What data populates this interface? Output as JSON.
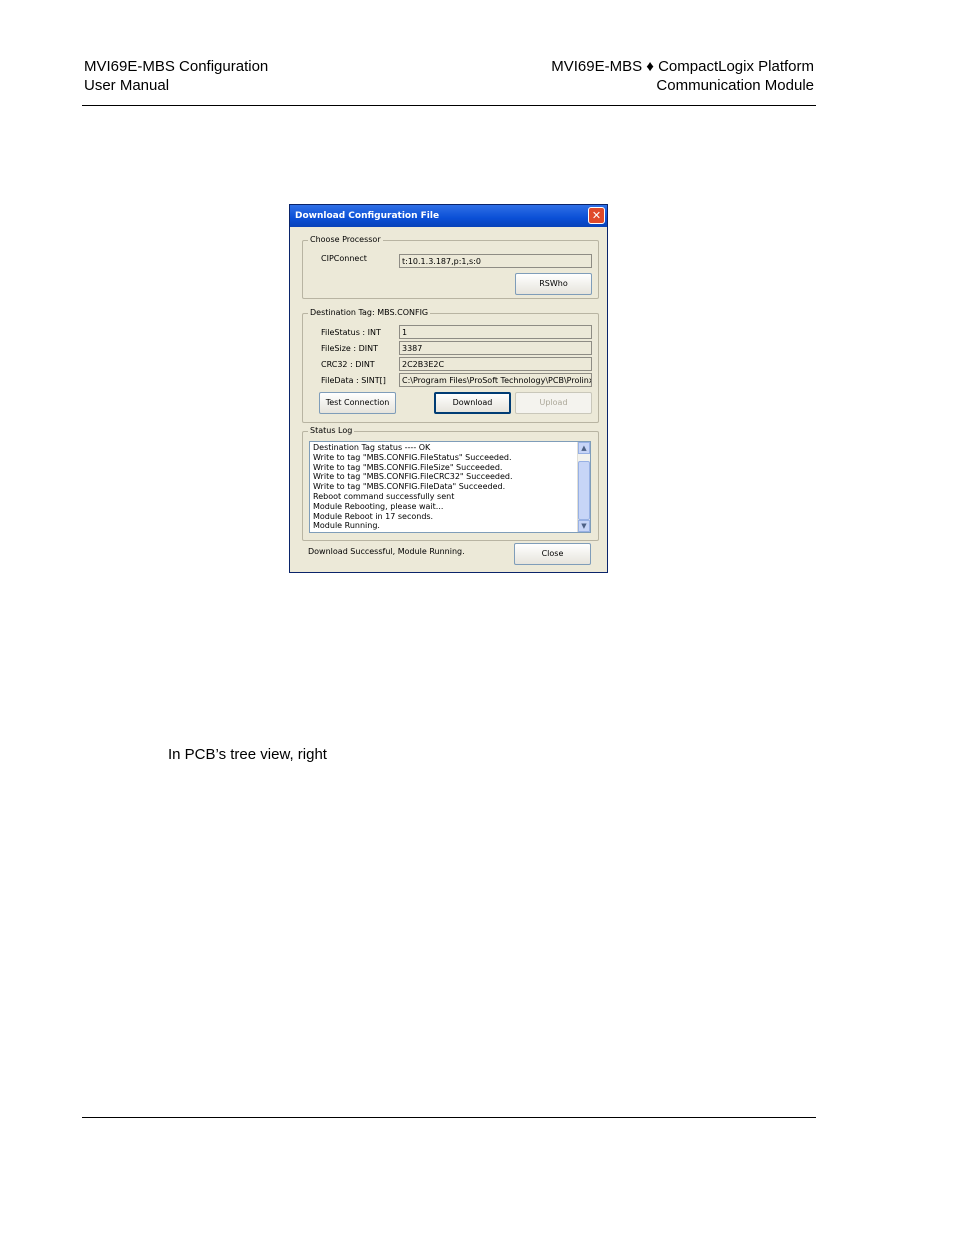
{
  "header": {
    "left_line1": "MVI69E-MBS Configuration",
    "left_line2": "User Manual",
    "right_line1": "MVI69E-MBS ♦ CompactLogix Platform",
    "right_line2": "Communication Module"
  },
  "body_text": "In PCB’s tree view, right",
  "dialog": {
    "title": "Download Configuration File",
    "choose_processor": {
      "group_label": "Choose Processor",
      "cipconnect_label": "CIPConnect",
      "cipconnect_value": "t:10.1.3.187,p:1,s:0",
      "rswho_button": "RSWho"
    },
    "destination": {
      "group_label": "Destination Tag: MBS.CONFIG",
      "rows": [
        {
          "label": "FileStatus : INT",
          "value": "1"
        },
        {
          "label": "FileSize    : DINT",
          "value": "3387"
        },
        {
          "label": "CRC32      : DINT",
          "value": "2C2B3E2C"
        },
        {
          "label": "FileData   : SINT[]",
          "value": "C:\\Program Files\\ProSoft Technology\\PCB\\Prolinx.c"
        }
      ],
      "test_button": "Test Connection",
      "download_button": "Download",
      "upload_button": "Upload"
    },
    "status_log": {
      "group_label": "Status Log",
      "lines": [
        "Destination Tag status ---- OK",
        "Write to tag \"MBS.CONFIG.FileStatus\" Succeeded.",
        "Write to tag \"MBS.CONFIG.FileSize\" Succeeded.",
        "Write to tag \"MBS.CONFIG.FileCRC32\" Succeeded.",
        "Write to tag \"MBS.CONFIG.FileData\" Succeeded.",
        "Reboot command successfully sent",
        "Module Rebooting, please wait...",
        "Module Reboot in 17 seconds.",
        "Module Running."
      ]
    },
    "status_message": "Download Successful, Module Running.",
    "close_button": "Close",
    "close_glyph": "✕"
  }
}
